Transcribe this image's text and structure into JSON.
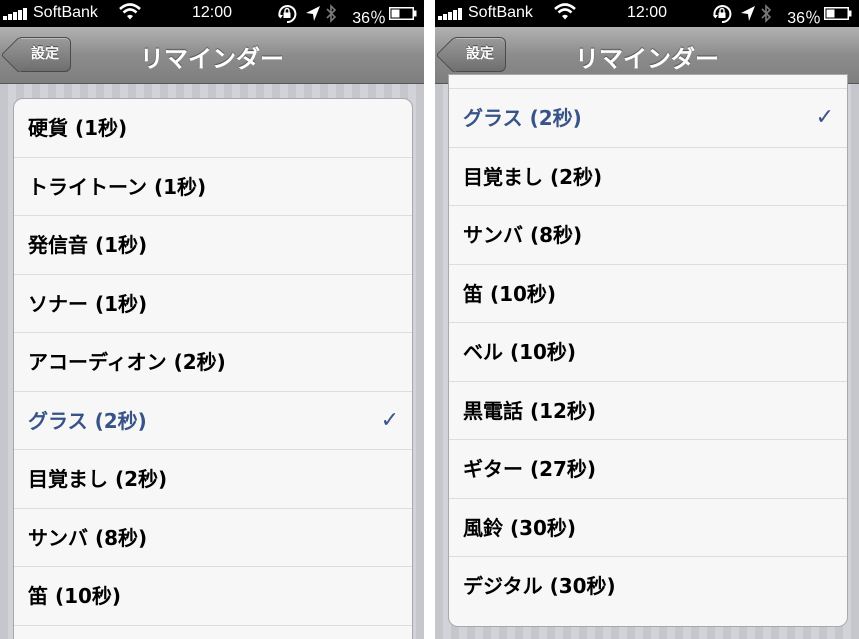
{
  "status_bar": {
    "carrier": "SoftBank",
    "time": "12:00",
    "battery_percent": "36％",
    "icons": [
      "signal-icon",
      "wifi-icon",
      "rotation-lock-icon",
      "location-icon",
      "bluetooth-icon",
      "battery-icon"
    ]
  },
  "nav": {
    "title": "リマインダー",
    "back_label": "設定"
  },
  "colors": {
    "selected_text": "#385487",
    "nav_bar": "#8c8c8c",
    "background_stripes": "#c5c7cc"
  },
  "left_screen": {
    "items": [
      {
        "label": "硬貨 (1秒)",
        "selected": false
      },
      {
        "label": "トライトーン (1秒)",
        "selected": false
      },
      {
        "label": "発信音 (1秒)",
        "selected": false
      },
      {
        "label": "ソナー (1秒)",
        "selected": false
      },
      {
        "label": "アコーディオン (2秒)",
        "selected": false
      },
      {
        "label": "グラス (2秒)",
        "selected": true
      },
      {
        "label": "目覚まし (2秒)",
        "selected": false
      },
      {
        "label": "サンバ (8秒)",
        "selected": false
      },
      {
        "label": "笛 (10秒)",
        "selected": false
      }
    ]
  },
  "right_screen": {
    "items": [
      {
        "label": "グラス (2秒)",
        "selected": true
      },
      {
        "label": "目覚まし (2秒)",
        "selected": false
      },
      {
        "label": "サンバ (8秒)",
        "selected": false
      },
      {
        "label": "笛 (10秒)",
        "selected": false
      },
      {
        "label": "ベル (10秒)",
        "selected": false
      },
      {
        "label": "黒電話 (12秒)",
        "selected": false
      },
      {
        "label": "ギター (27秒)",
        "selected": false
      },
      {
        "label": "風鈴 (30秒)",
        "selected": false
      },
      {
        "label": "デジタル (30秒)",
        "selected": false
      }
    ]
  },
  "checkmark_glyph": "✓"
}
